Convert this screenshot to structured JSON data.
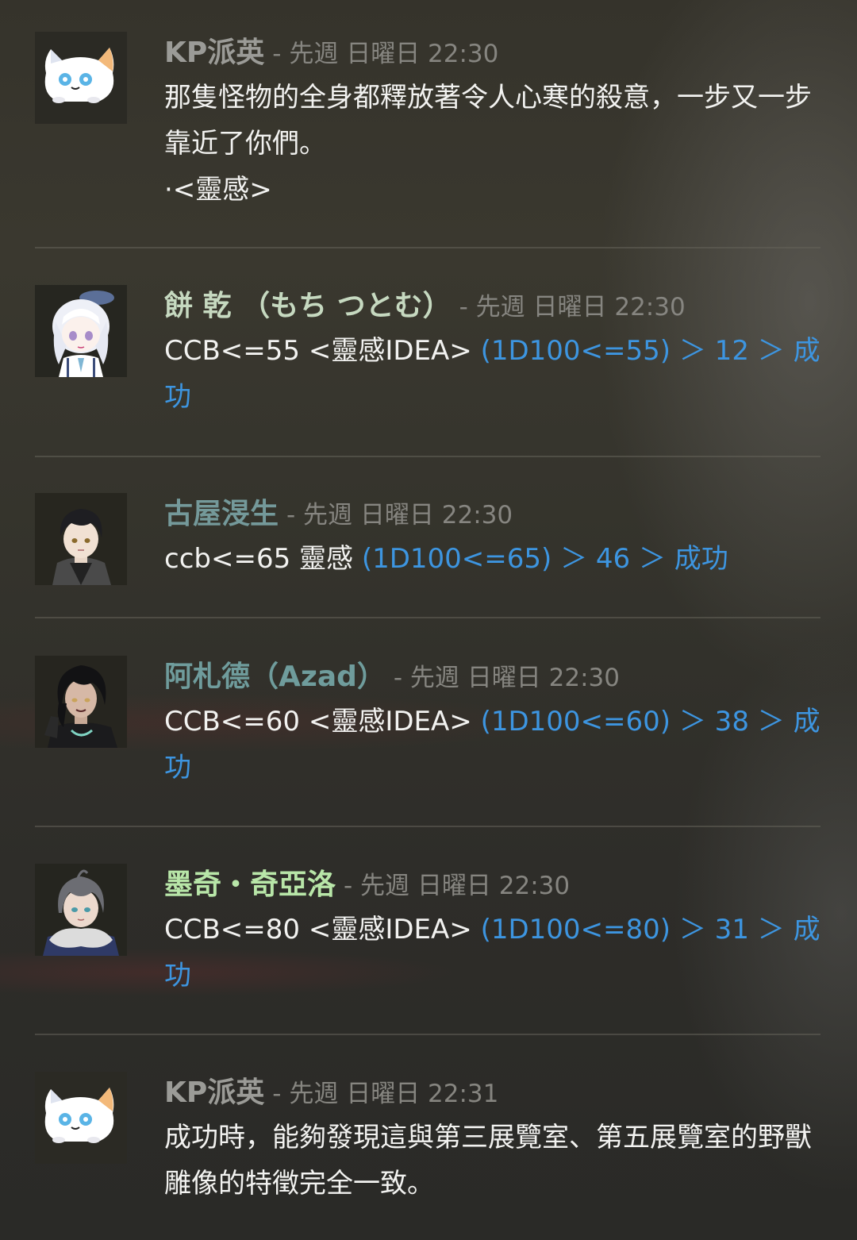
{
  "messages": [
    {
      "author": "KP派英",
      "author_color": "#9b9b97",
      "time": "- 先週 日曜日 22:30",
      "avatar": "white-cat-avatar",
      "text": "那隻怪物的全身都釋放著令人心寒的殺意，一步又一步靠近了你們。",
      "text2": "·<靈感>",
      "roll": ""
    },
    {
      "author": "餅 乾 （もち つとむ）",
      "author_color": "#c6d9c0",
      "time": "- 先週 日曜日 22:30",
      "avatar": "white-hair-girl-avatar",
      "text": "CCB<=55 <靈感IDEA> ",
      "text2": "",
      "roll": "(1D100<=55) ＞ 12 ＞ 成功"
    },
    {
      "author": "古屋渂生",
      "author_color": "#74999a",
      "time": "- 先週 日曜日 22:30",
      "avatar": "dark-hair-boy-avatar",
      "text": "ccb<=65 靈感 ",
      "text2": "",
      "roll": "(1D100<=65) ＞ 46 ＞ 成功"
    },
    {
      "author": "阿札德（Azad）",
      "author_color": "#6f9c9c",
      "time": "- 先週 日曜日 22:30",
      "avatar": "dark-curly-hair-man-avatar",
      "text": "CCB<=60 <靈感IDEA> ",
      "text2": "",
      "roll": "(1D100<=60) ＞ 38 ＞ 成功"
    },
    {
      "author": "墨奇・奇亞洛",
      "author_color": "#b8e6a8",
      "time": "- 先週 日曜日 22:30",
      "avatar": "grey-hair-fur-collar-avatar",
      "text": "CCB<=80 <靈感IDEA> ",
      "text2": "",
      "roll": "(1D100<=80) ＞ 31 ＞ 成功"
    },
    {
      "author": "KP派英",
      "author_color": "#9b9b97",
      "time": "- 先週 日曜日 22:31",
      "avatar": "white-cat-avatar",
      "text": "成功時，能夠發現這與第三展覽室、第五展覽室的野獸雕像的特徵完全一致。",
      "text2": "",
      "roll": ""
    }
  ]
}
